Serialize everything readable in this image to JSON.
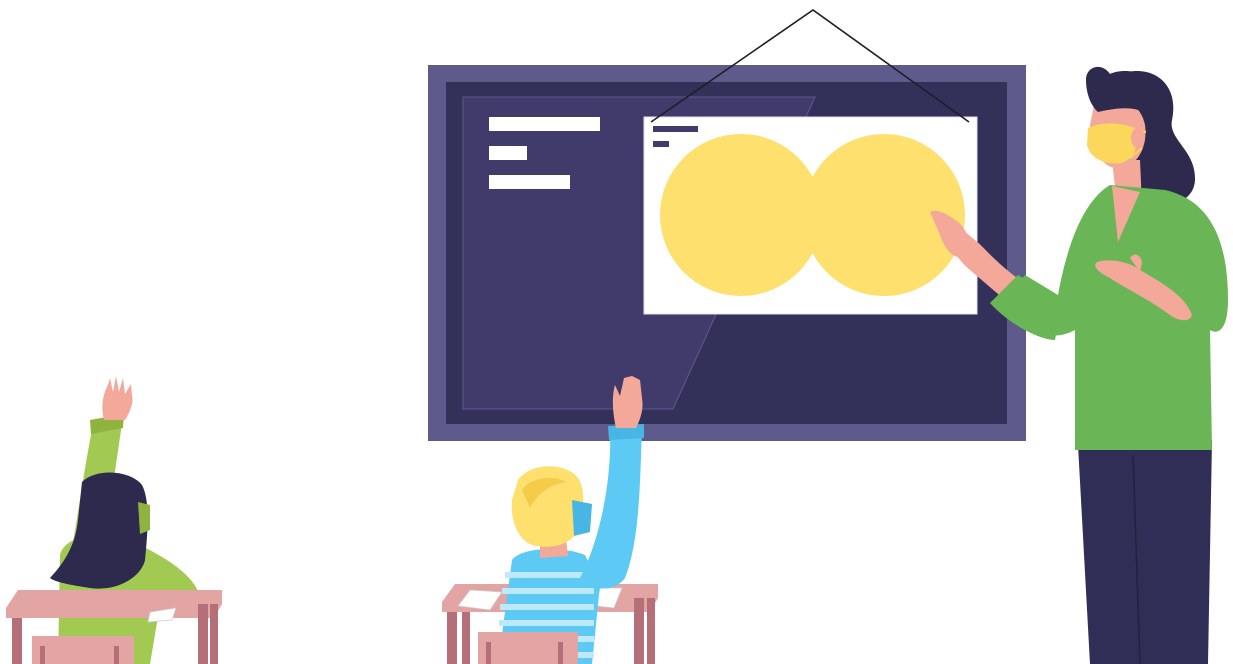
{
  "scene": {
    "colors": {
      "board_frame": "#5e5a8c",
      "board_surface": "#33305a",
      "board_panel": "#403b6b",
      "screen": "#ffffff",
      "venn_fill": "#fde06e",
      "teacher_shirt": "#6ab555",
      "teacher_pants": "#302d57",
      "hair_dark": "#2d2a4e",
      "mask_yellow": "#fbd85c",
      "skin": "#f3a89a",
      "student_left_shirt": "#a2c952",
      "student_right_shirt": "#5ccaf5",
      "student_right_hair": "#fde06e",
      "desk_top": "#e3a4a4",
      "desk_leg": "#b56f78"
    },
    "icons": [
      "venn-diagram-icon",
      "hanging-string-icon"
    ]
  }
}
